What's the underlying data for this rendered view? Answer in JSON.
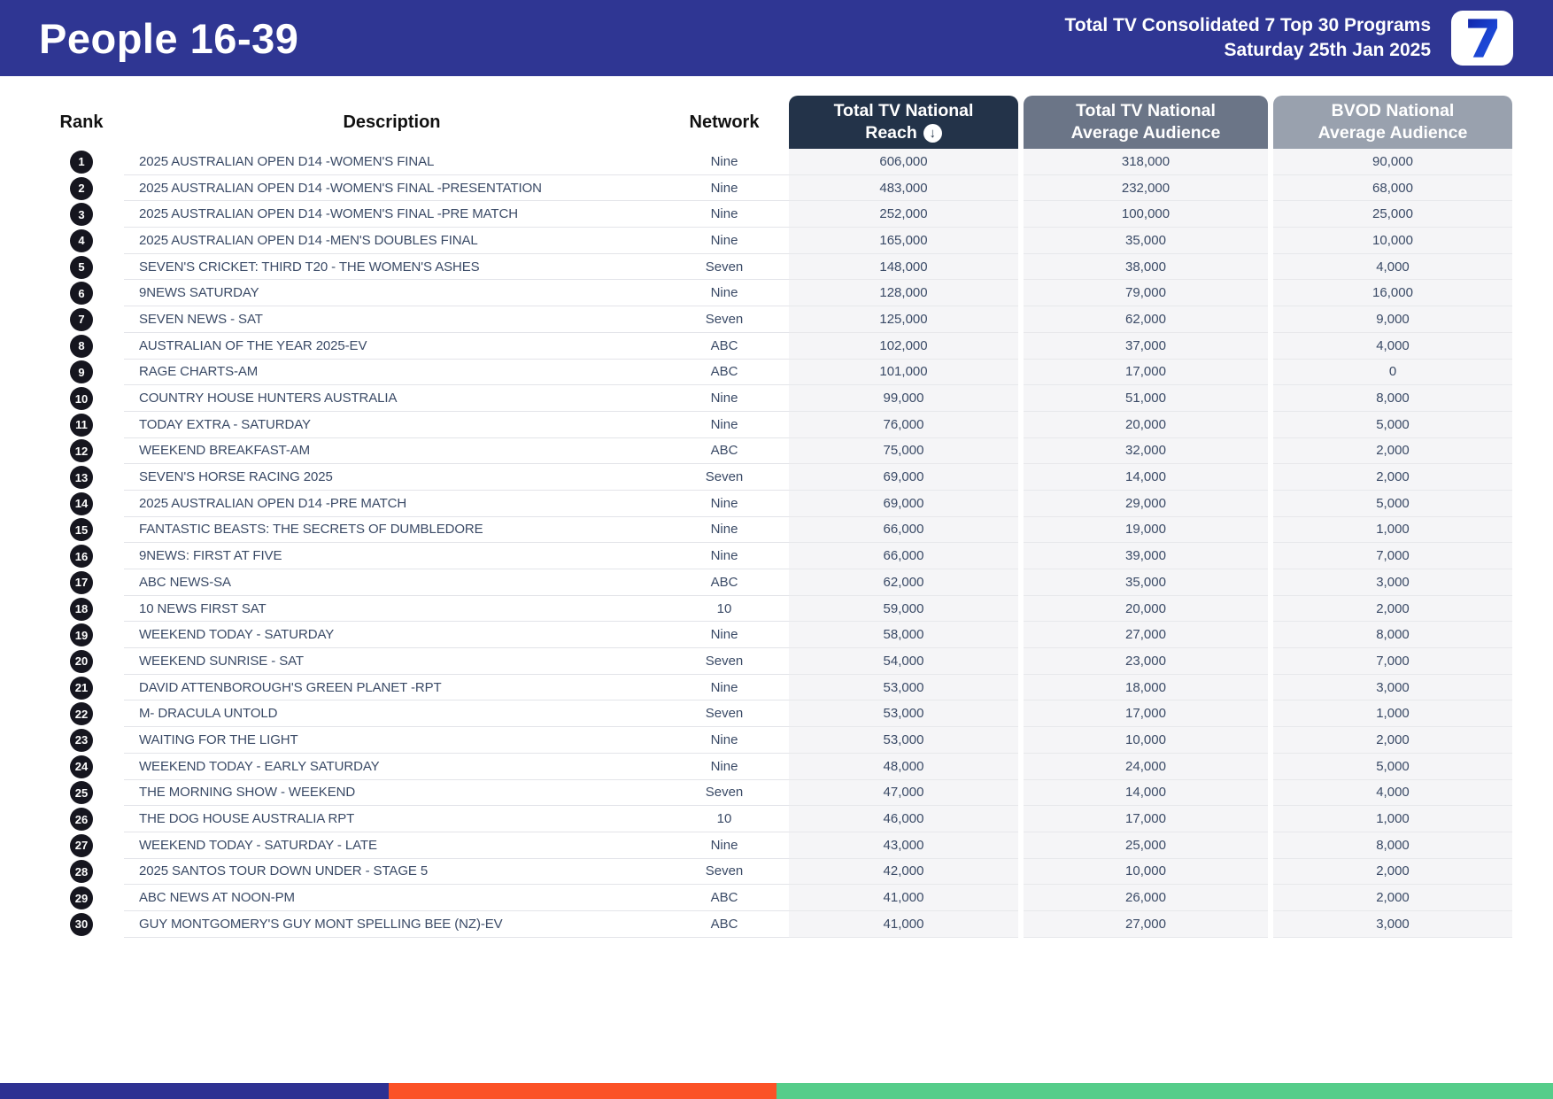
{
  "header": {
    "title": "People 16-39",
    "subtitle_line1": "Total TV Consolidated 7 Top 30 Programs",
    "subtitle_line2": "Saturday 25th Jan 2025",
    "logo_glyph": "7"
  },
  "colors": {
    "header_bg": "#2f3693",
    "reach_header_bg": "#233349",
    "avg_header_bg": "#6b7587",
    "bvod_header_bg": "#99a1ae",
    "value_cell_bg": "#f5f5f7",
    "rank_badge_bg": "#16161f",
    "footer_blue": "#2e3192",
    "footer_orange": "#fb5226",
    "footer_green": "#55cd8a"
  },
  "table": {
    "headers": {
      "rank": "Rank",
      "description": "Description",
      "network": "Network",
      "reach_line1": "Total TV National",
      "reach_line2": "Reach",
      "sort_icon": "↓",
      "avg_line1": "Total TV National",
      "avg_line2": "Average Audience",
      "bvod_line1": "BVOD National",
      "bvod_line2": "Average Audience"
    },
    "rows": [
      {
        "rank": "1",
        "description": "2025 AUSTRALIAN OPEN D14 -WOMEN'S FINAL",
        "network": "Nine",
        "reach": "606,000",
        "avg": "318,000",
        "bvod": "90,000"
      },
      {
        "rank": "2",
        "description": "2025 AUSTRALIAN OPEN D14 -WOMEN'S FINAL -PRESENTATION",
        "network": "Nine",
        "reach": "483,000",
        "avg": "232,000",
        "bvod": "68,000"
      },
      {
        "rank": "3",
        "description": "2025 AUSTRALIAN OPEN D14 -WOMEN'S FINAL -PRE MATCH",
        "network": "Nine",
        "reach": "252,000",
        "avg": "100,000",
        "bvod": "25,000"
      },
      {
        "rank": "4",
        "description": "2025 AUSTRALIAN OPEN D14 -MEN'S DOUBLES FINAL",
        "network": "Nine",
        "reach": "165,000",
        "avg": "35,000",
        "bvod": "10,000"
      },
      {
        "rank": "5",
        "description": "SEVEN'S CRICKET: THIRD T20 - THE WOMEN'S ASHES",
        "network": "Seven",
        "reach": "148,000",
        "avg": "38,000",
        "bvod": "4,000"
      },
      {
        "rank": "6",
        "description": "9NEWS SATURDAY",
        "network": "Nine",
        "reach": "128,000",
        "avg": "79,000",
        "bvod": "16,000"
      },
      {
        "rank": "7",
        "description": "SEVEN NEWS - SAT",
        "network": "Seven",
        "reach": "125,000",
        "avg": "62,000",
        "bvod": "9,000"
      },
      {
        "rank": "8",
        "description": "AUSTRALIAN OF THE YEAR 2025-EV",
        "network": "ABC",
        "reach": "102,000",
        "avg": "37,000",
        "bvod": "4,000"
      },
      {
        "rank": "9",
        "description": "RAGE CHARTS-AM",
        "network": "ABC",
        "reach": "101,000",
        "avg": "17,000",
        "bvod": "0"
      },
      {
        "rank": "10",
        "description": "COUNTRY HOUSE HUNTERS AUSTRALIA",
        "network": "Nine",
        "reach": "99,000",
        "avg": "51,000",
        "bvod": "8,000"
      },
      {
        "rank": "11",
        "description": "TODAY EXTRA - SATURDAY",
        "network": "Nine",
        "reach": "76,000",
        "avg": "20,000",
        "bvod": "5,000"
      },
      {
        "rank": "12",
        "description": "WEEKEND BREAKFAST-AM",
        "network": "ABC",
        "reach": "75,000",
        "avg": "32,000",
        "bvod": "2,000"
      },
      {
        "rank": "13",
        "description": "SEVEN'S HORSE RACING 2025",
        "network": "Seven",
        "reach": "69,000",
        "avg": "14,000",
        "bvod": "2,000"
      },
      {
        "rank": "14",
        "description": "2025 AUSTRALIAN OPEN D14 -PRE MATCH",
        "network": "Nine",
        "reach": "69,000",
        "avg": "29,000",
        "bvod": "5,000"
      },
      {
        "rank": "15",
        "description": "FANTASTIC BEASTS: THE SECRETS OF DUMBLEDORE",
        "network": "Nine",
        "reach": "66,000",
        "avg": "19,000",
        "bvod": "1,000"
      },
      {
        "rank": "16",
        "description": "9NEWS: FIRST AT FIVE",
        "network": "Nine",
        "reach": "66,000",
        "avg": "39,000",
        "bvod": "7,000"
      },
      {
        "rank": "17",
        "description": "ABC NEWS-SA",
        "network": "ABC",
        "reach": "62,000",
        "avg": "35,000",
        "bvod": "3,000"
      },
      {
        "rank": "18",
        "description": "10 NEWS FIRST SAT",
        "network": "10",
        "reach": "59,000",
        "avg": "20,000",
        "bvod": "2,000"
      },
      {
        "rank": "19",
        "description": "WEEKEND TODAY - SATURDAY",
        "network": "Nine",
        "reach": "58,000",
        "avg": "27,000",
        "bvod": "8,000"
      },
      {
        "rank": "20",
        "description": "WEEKEND SUNRISE - SAT",
        "network": "Seven",
        "reach": "54,000",
        "avg": "23,000",
        "bvod": "7,000"
      },
      {
        "rank": "21",
        "description": "DAVID ATTENBOROUGH'S GREEN PLANET -RPT",
        "network": "Nine",
        "reach": "53,000",
        "avg": "18,000",
        "bvod": "3,000"
      },
      {
        "rank": "22",
        "description": "M- DRACULA UNTOLD",
        "network": "Seven",
        "reach": "53,000",
        "avg": "17,000",
        "bvod": "1,000"
      },
      {
        "rank": "23",
        "description": "WAITING FOR THE LIGHT",
        "network": "Nine",
        "reach": "53,000",
        "avg": "10,000",
        "bvod": "2,000"
      },
      {
        "rank": "24",
        "description": "WEEKEND TODAY - EARLY SATURDAY",
        "network": "Nine",
        "reach": "48,000",
        "avg": "24,000",
        "bvod": "5,000"
      },
      {
        "rank": "25",
        "description": "THE MORNING SHOW - WEEKEND",
        "network": "Seven",
        "reach": "47,000",
        "avg": "14,000",
        "bvod": "4,000"
      },
      {
        "rank": "26",
        "description": "THE DOG HOUSE AUSTRALIA RPT",
        "network": "10",
        "reach": "46,000",
        "avg": "17,000",
        "bvod": "1,000"
      },
      {
        "rank": "27",
        "description": "WEEKEND TODAY - SATURDAY - LATE",
        "network": "Nine",
        "reach": "43,000",
        "avg": "25,000",
        "bvod": "8,000"
      },
      {
        "rank": "28",
        "description": "2025 SANTOS TOUR DOWN UNDER - STAGE 5",
        "network": "Seven",
        "reach": "42,000",
        "avg": "10,000",
        "bvod": "2,000"
      },
      {
        "rank": "29",
        "description": "ABC NEWS AT NOON-PM",
        "network": "ABC",
        "reach": "41,000",
        "avg": "26,000",
        "bvod": "2,000"
      },
      {
        "rank": "30",
        "description": "GUY MONTGOMERY'S GUY MONT SPELLING BEE (NZ)-EV",
        "network": "ABC",
        "reach": "41,000",
        "avg": "27,000",
        "bvod": "3,000"
      }
    ]
  }
}
